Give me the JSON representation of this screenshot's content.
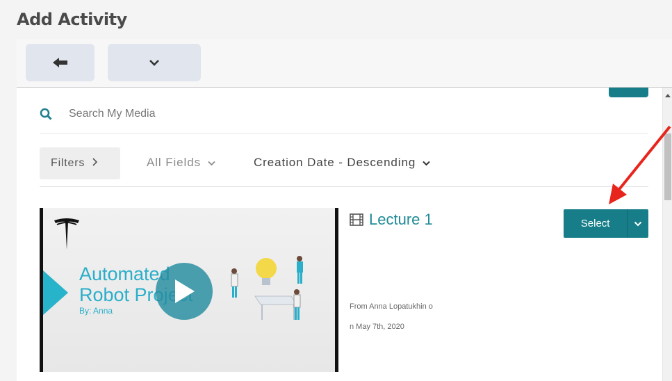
{
  "header": {
    "title": "Add Activity"
  },
  "toolbar": {
    "back_icon": "arrow-left-icon",
    "more_icon": "chevron-down-icon"
  },
  "search": {
    "placeholder": "Search My Media",
    "value": ""
  },
  "filters": {
    "filters_label": "Filters",
    "fields_label": "All Fields",
    "sort_label": "Creation Date - Descending"
  },
  "media": {
    "title": "Lecture 1",
    "meta_line1": "From Anna Lopatukhin o",
    "meta_line2": "n May 7th, 2020",
    "thumbnail": {
      "line1": "Automated",
      "line2": "Robot Project",
      "byline": "By: Anna"
    },
    "select_label": "Select"
  },
  "colors": {
    "accent": "#177e89",
    "link": "#1f8a98",
    "annotation": "#e8251c"
  }
}
